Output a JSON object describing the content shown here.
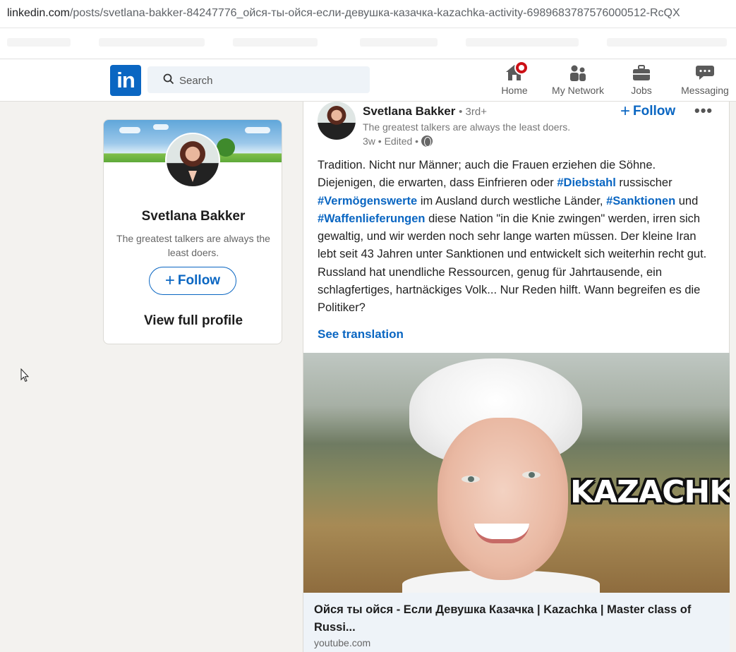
{
  "browser": {
    "url_host": "linkedin.com",
    "url_path": "/posts/svetlana-bakker-84247776_ойся-ты-ойся-если-девушка-казачка-kazachka-activity-6989683787576000512-RcQX"
  },
  "nav": {
    "logo_text": "in",
    "search_placeholder": "Search",
    "items": [
      {
        "label": "Home",
        "icon": "home-icon"
      },
      {
        "label": "My Network",
        "icon": "network-icon"
      },
      {
        "label": "Jobs",
        "icon": "briefcase-icon"
      },
      {
        "label": "Messaging",
        "icon": "messaging-icon"
      }
    ]
  },
  "profile_card": {
    "name": "Svetlana Bakker",
    "headline": "The greatest talkers are always the least doers.",
    "follow_label": "Follow",
    "view_profile_label": "View full profile"
  },
  "post": {
    "author": "Svetlana Bakker",
    "degree": "• 3rd+",
    "author_headline": "The greatest talkers are always the least doers.",
    "meta": "3w • Edited •",
    "follow_label": "Follow",
    "more_label": "•••",
    "text": {
      "p1": "Tradition. Nicht nur Männer; auch die Frauen erziehen die Söhne. Diejenigen, die erwarten, dass Einfrieren oder ",
      "h1": "#Diebstahl",
      "p2": " russischer ",
      "h2": "#Vermögenswerte",
      "p3": " im Ausland durch westliche Länder, ",
      "h3": "#Sanktionen",
      "p4": " und ",
      "h4": "#Waffenlieferungen",
      "p5": " diese Nation \"in die Knie zwingen\" werden, irren sich gewaltig, und wir werden noch sehr lange warten müssen. Der kleine Iran lebt seit 43 Jahren unter Sanktionen und entwickelt sich weiterhin recht gut. Russland hat unendliche Ressourcen, genug für Jahrtausende, ein schlagfertiges, hartnäckiges Volk... Nur Reden hilft. Wann begreifen es die Politiker?"
    },
    "see_translation": "See translation",
    "media_overlay_text": "KAZACHKA",
    "link_title": "Ойся ты ойся - Если Девушка Казачка | Kazachka | Master class of Russi...",
    "link_source": "youtube.com"
  },
  "colors": {
    "brand": "#0a66c2",
    "background": "#f3f2ef",
    "notification": "#cc1016"
  }
}
